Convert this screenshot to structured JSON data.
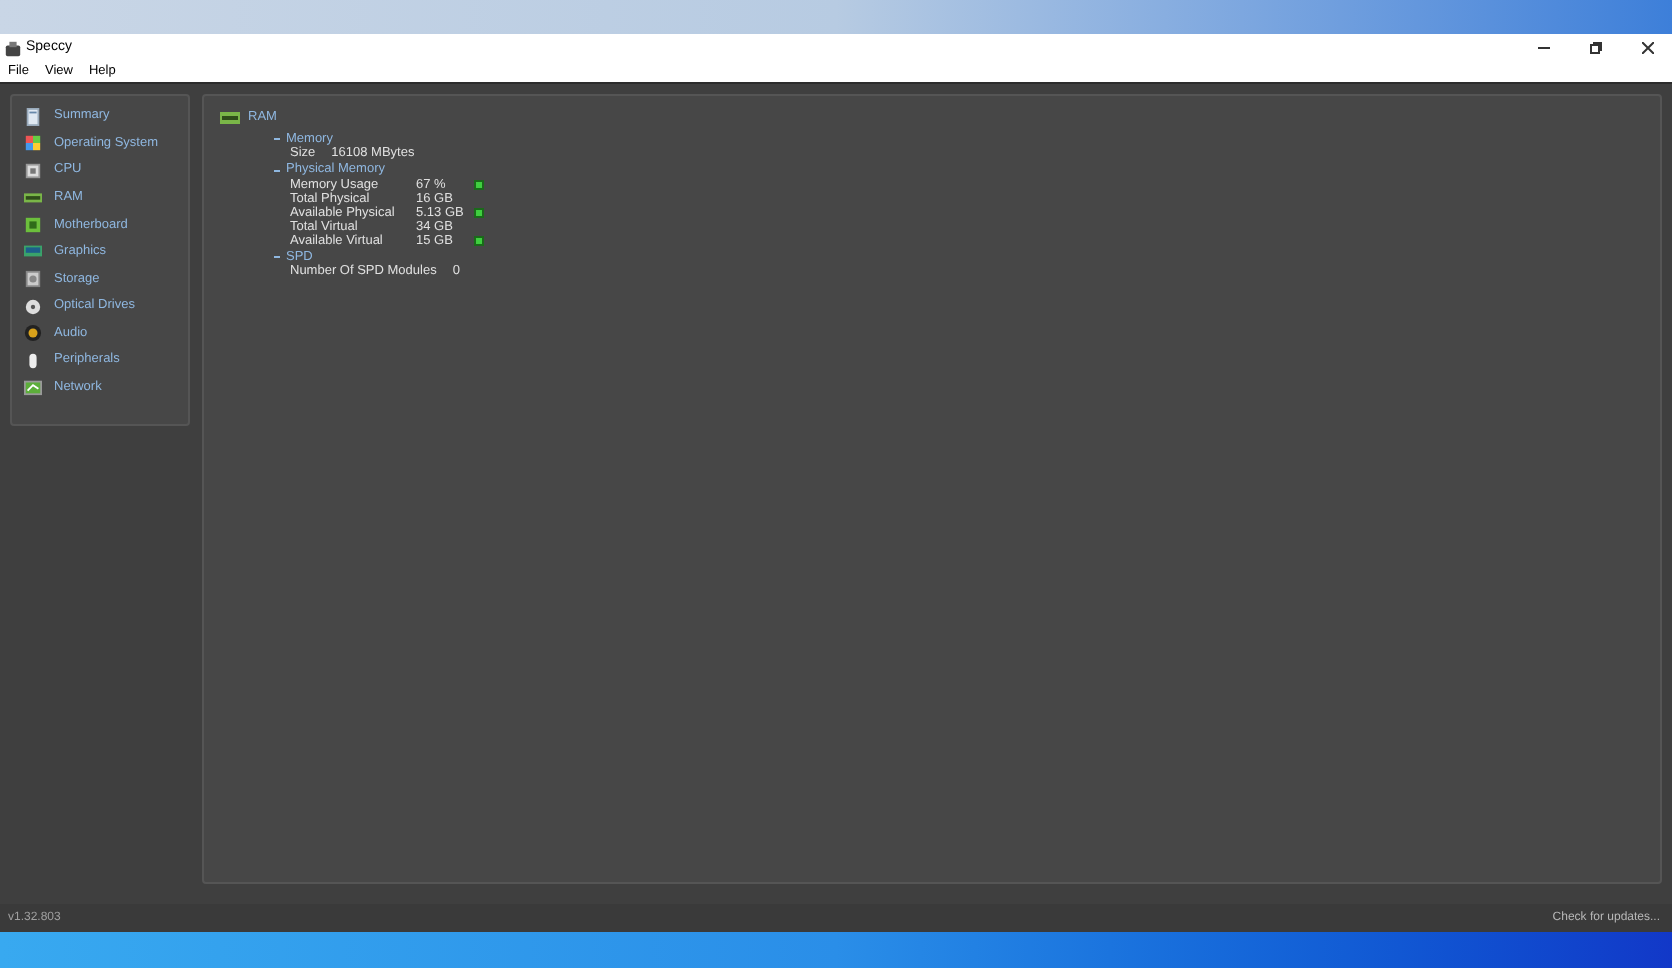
{
  "window": {
    "title": "Speccy"
  },
  "menu": [
    "File",
    "View",
    "Help"
  ],
  "sidebar": {
    "items": [
      {
        "label": "Summary"
      },
      {
        "label": "Operating System"
      },
      {
        "label": "CPU"
      },
      {
        "label": "RAM"
      },
      {
        "label": "Motherboard"
      },
      {
        "label": "Graphics"
      },
      {
        "label": "Storage"
      },
      {
        "label": "Optical Drives"
      },
      {
        "label": "Audio"
      },
      {
        "label": "Peripherals"
      },
      {
        "label": "Network"
      }
    ]
  },
  "main": {
    "title": "RAM",
    "sections": [
      {
        "name": "Memory",
        "expanded": true,
        "rows": [
          {
            "label": "Size",
            "value": "16108 MBytes",
            "indicator": false
          }
        ]
      },
      {
        "name": "Physical Memory",
        "expanded": true,
        "rows": [
          {
            "label": "Memory Usage",
            "value": "67 %",
            "indicator": true
          },
          {
            "label": "Total Physical",
            "value": "16 GB",
            "indicator": false
          },
          {
            "label": "Available Physical",
            "value": "5.13 GB",
            "indicator": true
          },
          {
            "label": "Total Virtual",
            "value": "34 GB",
            "indicator": false
          },
          {
            "label": "Available Virtual",
            "value": "15 GB",
            "indicator": true
          }
        ]
      },
      {
        "name": "SPD",
        "expanded": true,
        "rows": [
          {
            "label": "Number Of SPD Modules",
            "value": "0",
            "indicator": false
          }
        ]
      }
    ]
  },
  "status_bar": {
    "version": "v1.32.803",
    "update_link": "Check for updates..."
  }
}
